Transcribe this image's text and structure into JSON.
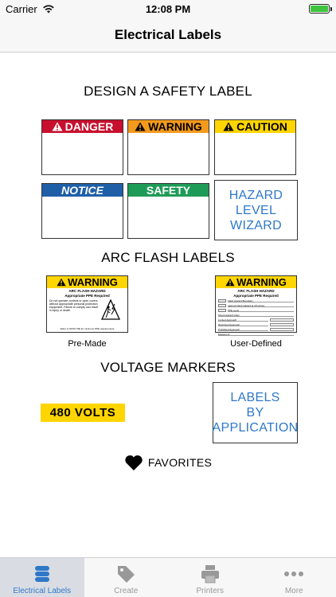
{
  "status_bar": {
    "carrier": "Carrier",
    "time": "12:08 PM",
    "battery_color": "#3ec43e"
  },
  "nav": {
    "title": "Electrical Labels"
  },
  "design_section": {
    "title": "DESIGN A SAFETY LABEL",
    "tiles": [
      {
        "label": "DANGER",
        "color": "#c8102e",
        "icon": "warning-triangle-icon"
      },
      {
        "label": "WARNING",
        "color": "#f39a1c",
        "icon": "warning-triangle-icon"
      },
      {
        "label": "CAUTION",
        "color": "#ffd500",
        "icon": "warning-triangle-icon"
      },
      {
        "label": "NOTICE",
        "color": "#1f5fa8"
      },
      {
        "label": "SAFETY",
        "color": "#1f9b58"
      }
    ],
    "wizard": {
      "line1": "HAZARD",
      "line2": "LEVEL",
      "line3": "WIZARD"
    }
  },
  "arc_section": {
    "title": "ARC FLASH LABELS",
    "premade": {
      "header": "WARNING",
      "sub1": "ARC FLASH HAZARD",
      "sub2": "Appropriate PPE Required",
      "body": "Do not operate controls or open covers without appropriate personal protection equipment. Failure to comply can result in injury or death.",
      "foot": "Refer to NFPA 70E for minimum PPE requirements",
      "caption": "Pre-Made"
    },
    "user_defined": {
      "header": "WARNING",
      "sub1": "ARC FLASH HAZARD",
      "sub2": "Appropriate PPE Required",
      "lines": [
        "Flash Hazard Boundary",
        "cal/cm2 Flash Hazard at 18 inches",
        "PPE Level",
        "Shock Hazard when",
        "Limited Approach",
        "Restricted Approach",
        "Prohibited Approach",
        "Equipment"
      ],
      "caption": "User-Defined"
    }
  },
  "voltage_section": {
    "title": "VOLTAGE MARKERS",
    "marker": "480 VOLTS",
    "by_application": {
      "line1": "LABELS",
      "line2": "BY",
      "line3": "APPLICATION"
    }
  },
  "favorites": {
    "label": "FAVORITES"
  },
  "tabs": [
    {
      "label": "Electrical Labels",
      "icon": "database-stack-icon",
      "active": true
    },
    {
      "label": "Create",
      "icon": "tag-icon",
      "active": false
    },
    {
      "label": "Printers",
      "icon": "printer-icon",
      "active": false
    },
    {
      "label": "More",
      "icon": "more-dots-icon",
      "active": false
    }
  ],
  "colors": {
    "accent": "#2f78c8",
    "danger": "#c8102e",
    "warning": "#f39a1c",
    "caution": "#ffd500",
    "notice": "#1f5fa8",
    "safety": "#1f9b58"
  }
}
